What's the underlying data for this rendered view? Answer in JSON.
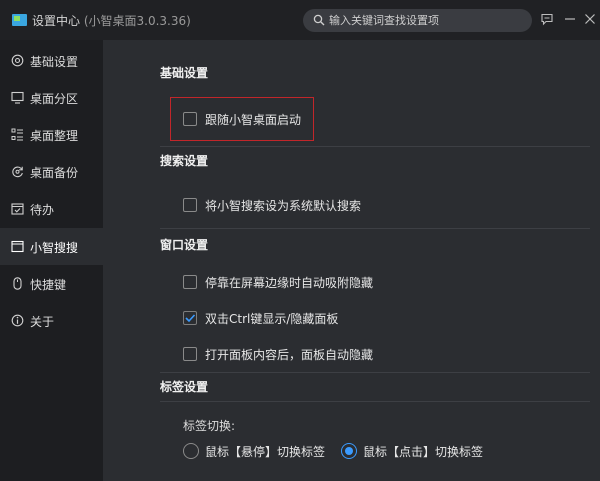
{
  "window": {
    "title": "设置中心",
    "version": "(小智桌面3.0.3.36)",
    "search_placeholder": "输入关键词查找设置项"
  },
  "sidebar": {
    "items": [
      {
        "label": "基础设置",
        "icon": "settings-circle-icon",
        "active": false
      },
      {
        "label": "桌面分区",
        "icon": "monitor-icon",
        "active": false
      },
      {
        "label": "桌面整理",
        "icon": "organize-icon",
        "active": false
      },
      {
        "label": "桌面备份",
        "icon": "backup-icon",
        "active": false
      },
      {
        "label": "待办",
        "icon": "calendar-check-icon",
        "active": false
      },
      {
        "label": "小智搜搜",
        "icon": "window-icon",
        "active": true
      },
      {
        "label": "快捷键",
        "icon": "mouse-icon",
        "active": false
      },
      {
        "label": "关于",
        "icon": "info-icon",
        "active": false
      }
    ]
  },
  "sections": {
    "basic": {
      "title": "基础设置",
      "options": [
        {
          "label": "跟随小智桌面启动",
          "checked": false
        }
      ]
    },
    "search": {
      "title": "搜索设置",
      "options": [
        {
          "label": "将小智搜索设为系统默认搜索",
          "checked": false
        }
      ]
    },
    "window": {
      "title": "窗口设置",
      "options": [
        {
          "label": "停靠在屏幕边缘时自动吸附隐藏",
          "checked": false
        },
        {
          "label": "双击Ctrl键显示/隐藏面板",
          "checked": true
        },
        {
          "label": "打开面板内容后，面板自动隐藏",
          "checked": false
        }
      ]
    },
    "tabs": {
      "title": "标签设置",
      "switch_label": "标签切换:",
      "radios": [
        {
          "label": "鼠标【悬停】切换标签",
          "selected": false
        },
        {
          "label": "鼠标【点击】切换标签",
          "selected": true
        }
      ]
    }
  },
  "colors": {
    "accent": "#3b9bff",
    "highlight_border": "#c2262a",
    "sidebar_bg": "#1d1e21",
    "main_bg": "#2b2d31"
  }
}
